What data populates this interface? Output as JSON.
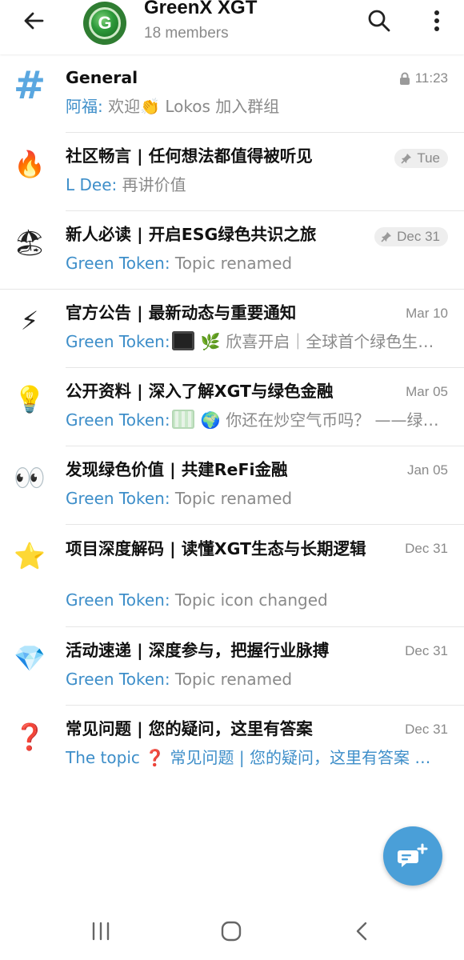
{
  "header": {
    "title": "GreenX XGT",
    "subtitle": "18 members",
    "avatar_letter": "G"
  },
  "topics": [
    {
      "icon": "hash-icon",
      "title": "General",
      "sender": "阿福:",
      "text": " 欢迎👏 Lokos 加入群组",
      "time": "11:23",
      "badge": "lock"
    },
    {
      "icon": "fire-icon",
      "glyph": "🔥",
      "title": "社区畅言 | 任何想法都值得被听见",
      "sender": "L Dee:",
      "text": " 再讲价值",
      "time": "Tue",
      "badge": "pin"
    },
    {
      "icon": "beach-umbrella-icon",
      "glyph": "🏖",
      "title": "新人必读 | 开启ESG绿色共识之旅",
      "sender": "Green Token:",
      "text": " Topic renamed",
      "time": "Dec 31",
      "badge": "pin"
    },
    {
      "icon": "lightning-icon",
      "glyph": "⚡",
      "title": "官方公告 | 最新动态与重要通知",
      "sender": "Green Token:",
      "text": " 🌿 欣喜开启｜全球首个绿色生态公链",
      "time": "Mar 10",
      "thumb": "dark"
    },
    {
      "icon": "lightbulb-icon",
      "glyph": "💡",
      "title": "公开资料 | 深入了解XGT与绿色金融",
      "sender": "Green Token:",
      "text": " 🌍 你还在炒空气币吗？ ——绿色金融",
      "time": "Mar 05",
      "thumb": "light"
    },
    {
      "icon": "eyes-icon",
      "glyph": "👀",
      "title": "发现绿色价值 | 共建ReFi金融",
      "sender": "Green Token:",
      "text": " Topic renamed",
      "time": "Jan 05"
    },
    {
      "icon": "star-icon",
      "glyph": "⭐",
      "title": "项目深度解码 | 读懂XGT生态与长期逻辑",
      "sender": "Green Token:",
      "text": " Topic icon changed",
      "time": "Dec 31"
    },
    {
      "icon": "diamond-icon",
      "glyph": "💎",
      "title": "活动速递 | 深度参与，把握行业脉搏",
      "sender": "Green Token:",
      "text": " Topic renamed",
      "time": "Dec 31"
    },
    {
      "icon": "question-mark-icon",
      "glyph": "❓",
      "title": "常见问题 | 您的疑问，这里有答案",
      "sender": "",
      "text": "The topic ❓ 常见问题 | 您的疑问，这里有答案 was created",
      "time": "Dec 31"
    }
  ],
  "colors": {
    "accent": "#4a9fd8",
    "sender": "#3d8ec9",
    "muted": "#8a8a8a"
  }
}
